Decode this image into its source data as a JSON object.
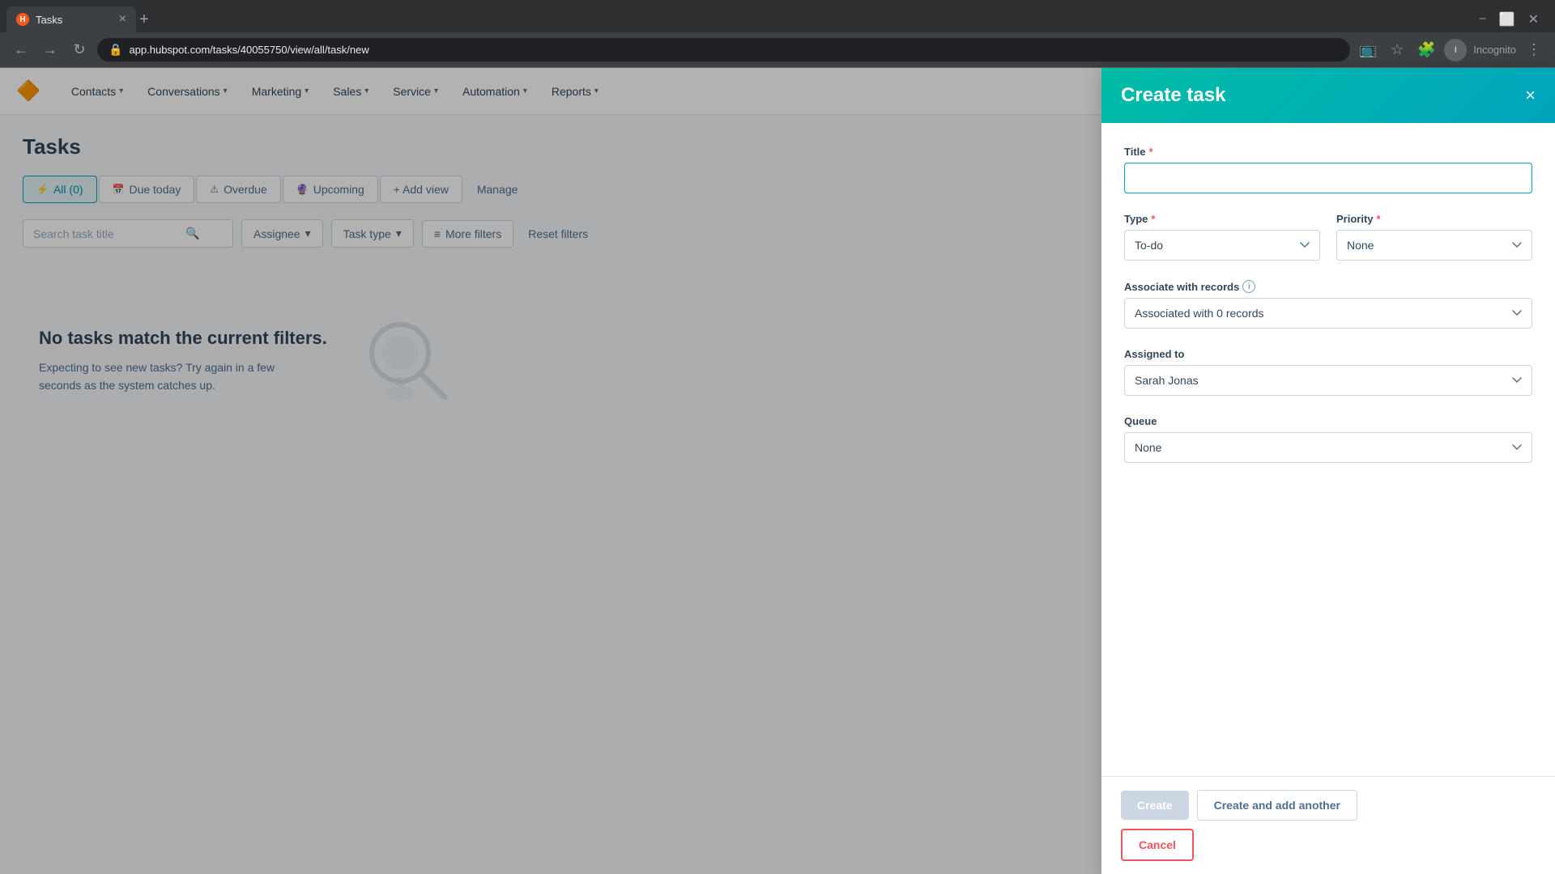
{
  "browser": {
    "tab_title": "Tasks",
    "favicon_text": "H",
    "url": "app.hubspot.com/tasks/40055750/view/all/task/new",
    "incognito_label": "Incognito"
  },
  "nav": {
    "logo": "🔶",
    "items": [
      {
        "label": "Contacts",
        "id": "contacts"
      },
      {
        "label": "Conversations",
        "id": "conversations"
      },
      {
        "label": "Marketing",
        "id": "marketing"
      },
      {
        "label": "Sales",
        "id": "sales"
      },
      {
        "label": "Service",
        "id": "service"
      },
      {
        "label": "Automation",
        "id": "automation"
      },
      {
        "label": "Reports",
        "id": "reports"
      }
    ]
  },
  "page": {
    "title": "Tasks"
  },
  "view_tabs": [
    {
      "label": "All (0)",
      "active": true,
      "id": "all"
    },
    {
      "label": "Due today",
      "active": false,
      "id": "due-today"
    },
    {
      "label": "Overdue",
      "active": false,
      "id": "overdue"
    },
    {
      "label": "Upcoming",
      "active": false,
      "id": "upcoming"
    },
    {
      "label": "+ Add view",
      "id": "add-view"
    },
    {
      "label": "Manage",
      "id": "manage"
    }
  ],
  "filters": {
    "search_placeholder": "Search task title",
    "assignee_label": "Assignee",
    "task_type_label": "Task type",
    "more_filters_label": "More filters",
    "reset_label": "Reset filters"
  },
  "empty_state": {
    "title": "No tasks match the current filters.",
    "subtitle": "Expecting to see new tasks? Try again in a few seconds as the system catches up."
  },
  "panel": {
    "title": "Create task",
    "close_label": "×",
    "title_label": "Title",
    "title_required": "*",
    "title_placeholder": "",
    "type_label": "Type",
    "type_required": "*",
    "type_value": "To-do",
    "priority_label": "Priority",
    "priority_required": "*",
    "priority_value": "None",
    "associate_label": "Associate with records",
    "associate_value": "Associated with 0 records",
    "assigned_to_label": "Assigned to",
    "assigned_to_value": "Sarah Jonas",
    "queue_label": "Queue",
    "queue_value": "None",
    "btn_create": "Create",
    "btn_create_add": "Create and add another",
    "btn_cancel": "Cancel"
  }
}
